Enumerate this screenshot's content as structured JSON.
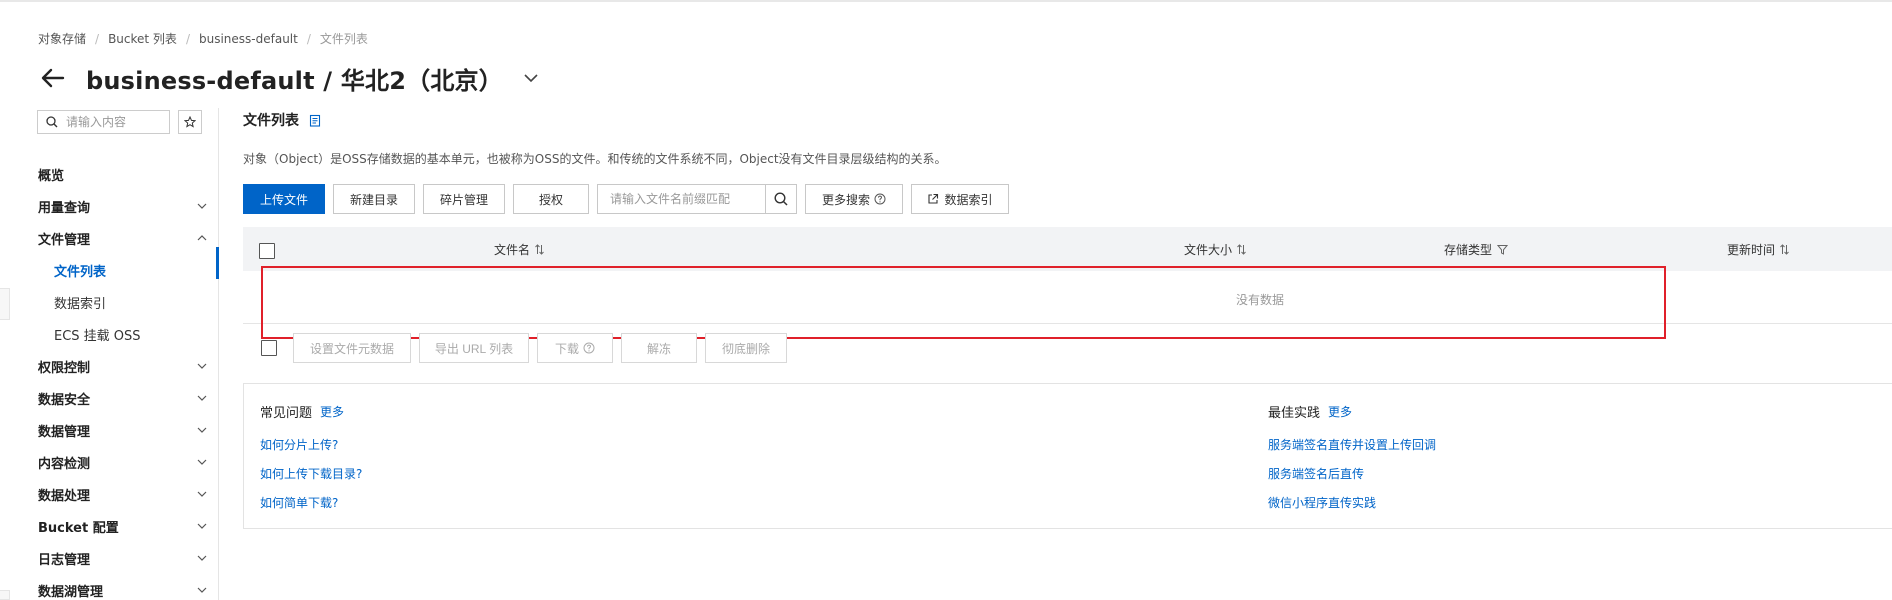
{
  "breadcrumb": {
    "items": [
      "对象存储",
      "Bucket 列表",
      "business-default",
      "文件列表"
    ]
  },
  "header": {
    "title": "business-default / 华北2（北京）"
  },
  "sidebar": {
    "search_placeholder": "请输入内容",
    "items": [
      {
        "label": "概览"
      },
      {
        "label": "用量查询"
      },
      {
        "label": "文件管理"
      },
      {
        "label": "文件列表"
      },
      {
        "label": "数据索引"
      },
      {
        "label": "ECS 挂载 OSS"
      },
      {
        "label": "权限控制"
      },
      {
        "label": "数据安全"
      },
      {
        "label": "数据管理"
      },
      {
        "label": "内容检测"
      },
      {
        "label": "数据处理"
      },
      {
        "label": "Bucket 配置"
      },
      {
        "label": "日志管理"
      },
      {
        "label": "数据湖管理"
      }
    ],
    "active_item": "文件列表"
  },
  "main": {
    "section_title": "文件列表",
    "description": "对象（Object）是OSS存储数据的基本单元，也被称为OSS的文件。和传统的文件系统不同，Object没有文件目录层级结构的关系。",
    "toolbar": {
      "upload_label": "上传文件",
      "new_dir_label": "新建目录",
      "fragment_label": "碎片管理",
      "authorize_label": "授权",
      "search_placeholder": "请输入文件名前缀匹配",
      "more_search_label": "更多搜索",
      "data_index_label": "数据索引"
    },
    "table": {
      "columns": [
        "文件名",
        "文件大小",
        "存储类型",
        "更新时间"
      ],
      "rows": [],
      "empty_text": "没有数据"
    },
    "batch_actions": {
      "set_meta_label": "设置文件元数据",
      "export_url_label": "导出 URL 列表",
      "download_label": "下载",
      "unfreeze_label": "解冻",
      "delete_label": "彻底删除"
    },
    "help": {
      "faq_title": "常见问题",
      "faq_more": "更多",
      "faq_links": [
        "如何分片上传?",
        "如何上传下载目录?",
        "如何简单下载?"
      ],
      "best_title": "最佳实践",
      "best_more": "更多",
      "best_links": [
        "服务端签名直传并设置上传回调",
        "服务端签名后直传",
        "微信小程序直传实践"
      ]
    }
  },
  "colors": {
    "accent": "#0064c8",
    "highlight": "#e0202a"
  }
}
